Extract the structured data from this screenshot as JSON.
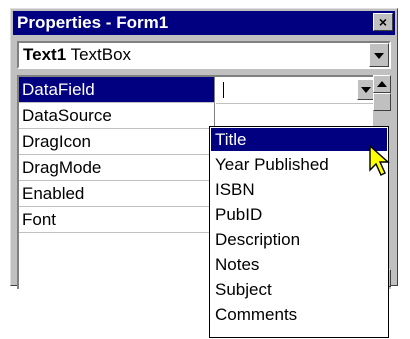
{
  "window": {
    "title": "Properties - Form1",
    "close_glyph": "×"
  },
  "object_combo": {
    "name": "Text1",
    "type": "TextBox"
  },
  "properties": [
    {
      "name": "DataField"
    },
    {
      "name": "DataSource"
    },
    {
      "name": "DragIcon"
    },
    {
      "name": "DragMode"
    },
    {
      "name": "Enabled"
    },
    {
      "name": "Font"
    }
  ],
  "dropdown": {
    "items": [
      "Title",
      "Year Published",
      "ISBN",
      "PubID",
      "Description",
      "Notes",
      "Subject",
      "Comments"
    ],
    "selected": "Title"
  },
  "colors": {
    "selection": "#000080",
    "face": "#c0c0c0"
  }
}
